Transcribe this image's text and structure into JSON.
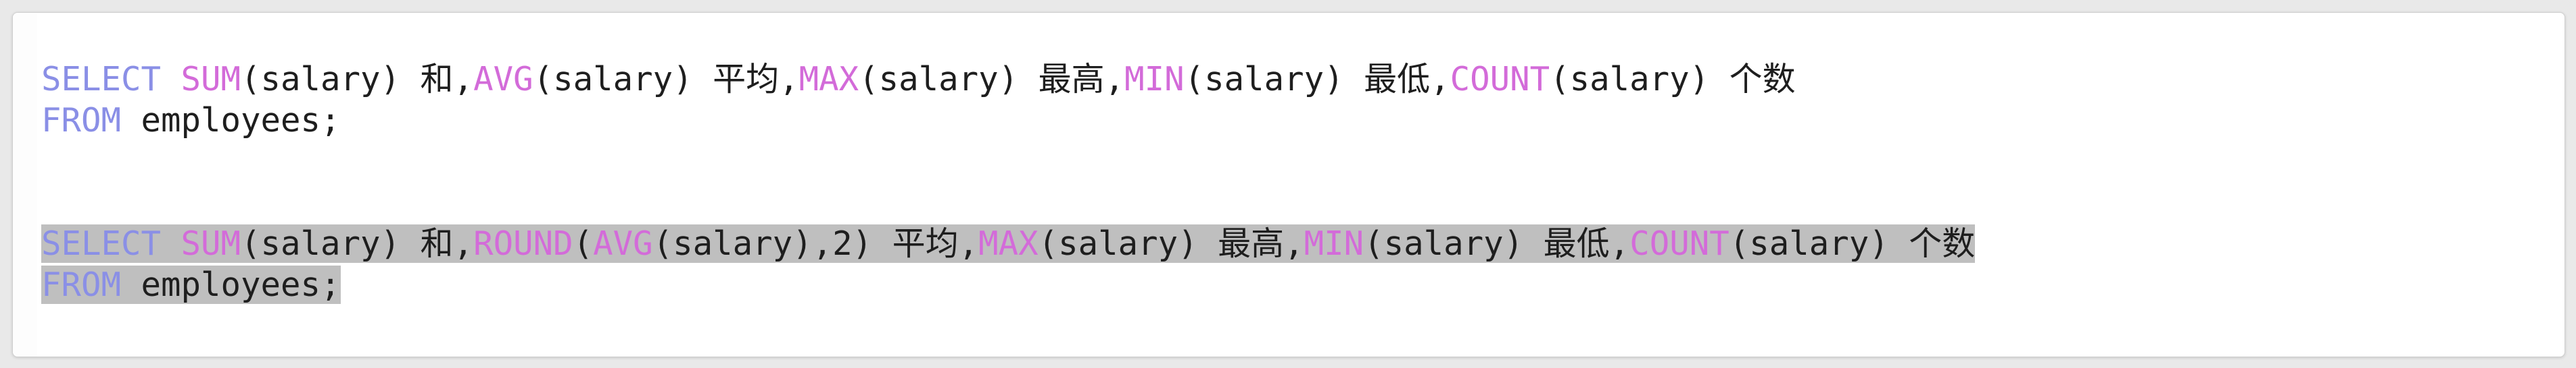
{
  "editor": {
    "lines": [
      {
        "selected": false,
        "tokens": [
          {
            "t": "SELECT",
            "c": "kw"
          },
          {
            "t": " ",
            "c": "txt"
          },
          {
            "t": "SUM",
            "c": "fn"
          },
          {
            "t": "(salary) 和,",
            "c": "txt"
          },
          {
            "t": "AVG",
            "c": "fn"
          },
          {
            "t": "(salary) 平均,",
            "c": "txt"
          },
          {
            "t": "MAX",
            "c": "fn"
          },
          {
            "t": "(salary) 最高,",
            "c": "txt"
          },
          {
            "t": "MIN",
            "c": "fn"
          },
          {
            "t": "(salary) 最低,",
            "c": "txt"
          },
          {
            "t": "COUNT",
            "c": "fn"
          },
          {
            "t": "(salary) 个数",
            "c": "txt"
          }
        ]
      },
      {
        "selected": false,
        "tokens": [
          {
            "t": "FROM",
            "c": "kw"
          },
          {
            "t": " employees;",
            "c": "txt"
          }
        ]
      },
      {
        "selected": false,
        "blank": true,
        "tokens": []
      },
      {
        "selected": true,
        "tokens": [
          {
            "t": "SELECT",
            "c": "kw"
          },
          {
            "t": " ",
            "c": "txt"
          },
          {
            "t": "SUM",
            "c": "fn"
          },
          {
            "t": "(salary) 和,",
            "c": "txt"
          },
          {
            "t": "ROUND",
            "c": "fn"
          },
          {
            "t": "(",
            "c": "txt"
          },
          {
            "t": "AVG",
            "c": "fn"
          },
          {
            "t": "(salary),2) 平均,",
            "c": "txt"
          },
          {
            "t": "MAX",
            "c": "fn"
          },
          {
            "t": "(salary) 最高,",
            "c": "txt"
          },
          {
            "t": "MIN",
            "c": "fn"
          },
          {
            "t": "(salary) 最低,",
            "c": "txt"
          },
          {
            "t": "COUNT",
            "c": "fn"
          },
          {
            "t": "(salary) 个数",
            "c": "txt"
          }
        ]
      },
      {
        "selected": true,
        "tokens": [
          {
            "t": "FROM",
            "c": "kw"
          },
          {
            "t": " employees;",
            "c": "txt"
          }
        ]
      }
    ]
  },
  "colors": {
    "keyword": "#8a8fe6",
    "function": "#d36bd9",
    "text": "#1e1e1e",
    "selection": "#bfbfbf",
    "editor_background": "#ffffff"
  }
}
